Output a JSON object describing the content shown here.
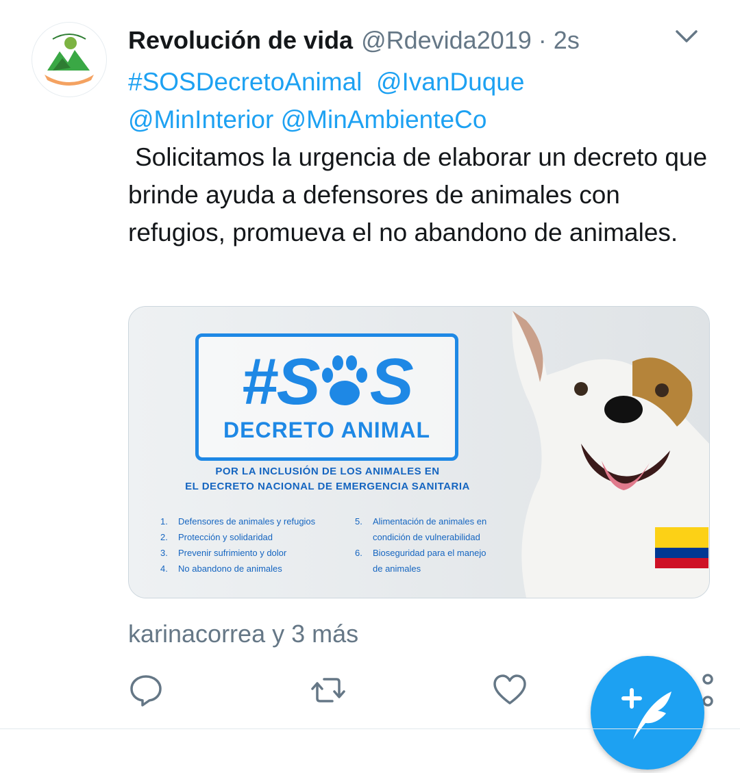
{
  "tweet": {
    "author_name": "Revolución de vida",
    "author_handle": "@Rdevida2019",
    "separator": "·",
    "time": "2s",
    "avatar_text": "Revolución de vida",
    "text_tags_line1": [
      "#SOSDecretoAnimal",
      "@IvanDuque"
    ],
    "text_tags_line2": [
      "@MinInterior",
      "@MinAmbienteCo"
    ],
    "text_body": "Solicitamos la urgencia de elaborar un decreto que brinde  ayuda a defensores de animales con refugios, promueva el no abandono de animales.",
    "likers": "karinacorrea y 3 más"
  },
  "media": {
    "title_hash": "#S",
    "title_tail": "S",
    "subtitle": "DECRETO ANIMAL",
    "banner_line1": "POR LA INCLUSIÓN DE LOS ANIMALES EN",
    "banner_line2": "EL DECRETO NACIONAL DE EMERGENCIA SANITARIA",
    "list_left": [
      {
        "num": "1.",
        "text": "Defensores de animales y refugios"
      },
      {
        "num": "2.",
        "text": "Protección y solidaridad"
      },
      {
        "num": "3.",
        "text": "Prevenir sufrimiento y dolor"
      },
      {
        "num": "4.",
        "text": "No abandono de animales"
      }
    ],
    "list_right": [
      {
        "num": "5.",
        "text": "Alimentación de animales en"
      },
      {
        "num": "",
        "text": "condición de vulnerabilidad"
      },
      {
        "num": "6.",
        "text": "Bioseguridad para el manejo"
      },
      {
        "num": "",
        "text": "de animales"
      }
    ],
    "flag_colors": [
      "#fcd116",
      "#003893",
      "#ce1126"
    ]
  },
  "colors": {
    "accent": "#1da1f2",
    "muted": "#657786",
    "poster_blue": "#1e88e5"
  },
  "icons": {
    "chevron": "chevron-down-icon",
    "reply": "reply-icon",
    "retweet": "retweet-icon",
    "like": "heart-icon",
    "share": "share-icon",
    "compose": "compose-feather-icon"
  }
}
